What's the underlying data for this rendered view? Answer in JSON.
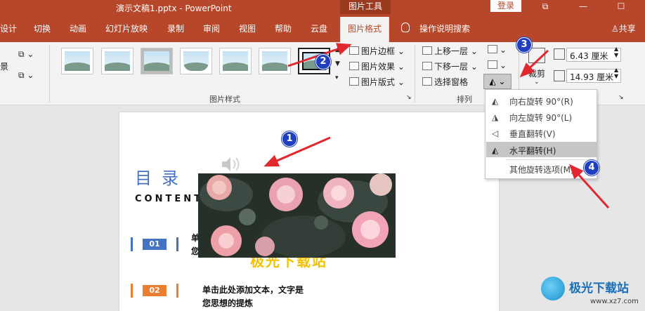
{
  "titlebar": {
    "title": "演示文稿1.pptx  -  PowerPoint",
    "context_tab": "图片工具",
    "login_label": "登录",
    "controls": [
      "⧉",
      "—",
      "☐"
    ]
  },
  "tabs": {
    "items": [
      {
        "label": "设计"
      },
      {
        "label": "切换"
      },
      {
        "label": "动画"
      },
      {
        "label": "幻灯片放映"
      },
      {
        "label": "录制"
      },
      {
        "label": "审阅"
      },
      {
        "label": "视图"
      },
      {
        "label": "帮助"
      },
      {
        "label": "云盘"
      },
      {
        "label": "图片格式"
      }
    ],
    "search_label": "操作说明搜索",
    "share_label": "共享"
  },
  "ribbon": {
    "left_fragment": "景",
    "styles_group_label": "图片样式",
    "arrange_group_label": "排列",
    "picture_border": "图片边框",
    "picture_effects": "图片效果",
    "picture_layout": "图片版式",
    "bring_forward": "上移一层",
    "send_backward": "下移一层",
    "selection_pane": "选择窗格",
    "crop_label": "裁剪",
    "height_value": "6.43 厘米",
    "width_value": "14.93 厘米"
  },
  "rotate_menu": {
    "items": [
      {
        "label": "向右旋转 90°(R)",
        "icon": "rotate-right-icon"
      },
      {
        "label": "向左旋转 90°(L)",
        "icon": "rotate-left-icon"
      },
      {
        "label": "垂直翻转(V)",
        "icon": "flip-vertical-icon"
      },
      {
        "label": "水平翻转(H)",
        "icon": "flip-horizontal-icon",
        "highlighted": true
      },
      {
        "label": "其他旋转选项(M)..."
      }
    ]
  },
  "slide": {
    "title": "目录",
    "subtitle": "CONTENT",
    "item1_number": "01",
    "item1_fragment": "单\n您",
    "item2_number": "02",
    "item2_text_line1": "单击此处添加文本，文字是",
    "item2_text_line2": "您思想的提炼",
    "yellow_text": "极光下载站"
  },
  "annotations": {
    "markers": [
      "1",
      "2",
      "3",
      "4"
    ],
    "arrow_color": "#e0282e"
  },
  "watermark": {
    "brand": "极光下载站",
    "url": "www.xz7.com"
  },
  "colors": {
    "accent": "#b7472a",
    "blue": "#4472c4",
    "orange": "#ed7d31"
  }
}
